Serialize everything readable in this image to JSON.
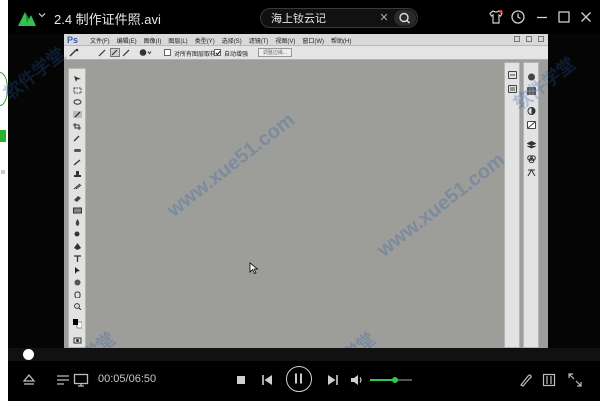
{
  "app": {
    "file_title": "2.4  制作证件照.avi",
    "search_value": "海上钕云记"
  },
  "titlebar_icons": [
    "shirt-icon",
    "clock-icon",
    "minimize-icon",
    "maximize-icon",
    "close-icon"
  ],
  "photoshop": {
    "logo": "Ps",
    "menus": [
      "文件(F)",
      "编辑(E)",
      "图像(I)",
      "图层(L)",
      "类型(Y)",
      "选择(S)",
      "滤镜(T)",
      "视图(V)",
      "窗口(W)",
      "帮助(H)"
    ],
    "options": {
      "sample_all": "对所有图层取样",
      "auto_enhance": "自动增强",
      "refine_edge": "调整边缘..."
    }
  },
  "playback": {
    "current_time": "00:05",
    "total_time": "06:50",
    "time_display": "00:05/06:50",
    "progress": 0.012,
    "volume": 0.6
  },
  "watermarks": [
    "软件学堂",
    "www.xue51.com"
  ],
  "colors": {
    "accent_green": "#2ec94a",
    "ps_canvas": "#9d9e9a"
  }
}
